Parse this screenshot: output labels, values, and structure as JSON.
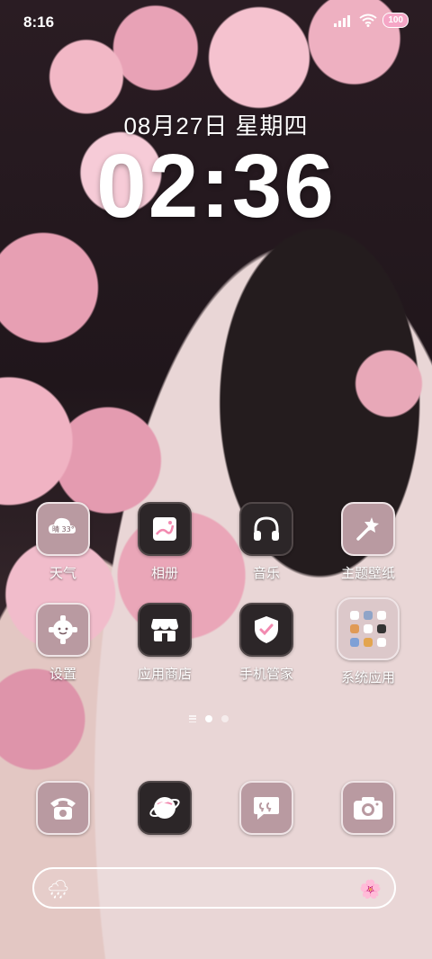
{
  "status": {
    "time": "8:16",
    "battery": "100"
  },
  "lockscreen": {
    "date": "08月27日  星期四",
    "clock": "02:36"
  },
  "apps_row1": [
    {
      "name": "天气",
      "badge_text": "晴 33°"
    },
    {
      "name": "相册"
    },
    {
      "name": "音乐"
    },
    {
      "name": "主题壁纸"
    }
  ],
  "apps_row2": [
    {
      "name": "设置"
    },
    {
      "name": "应用商店"
    },
    {
      "name": "手机管家"
    },
    {
      "name": "系统应用"
    }
  ],
  "dock": [
    {
      "icon": "phone-icon"
    },
    {
      "icon": "browser-icon"
    },
    {
      "icon": "messages-icon"
    },
    {
      "icon": "camera-icon"
    }
  ],
  "search": {
    "left_icon": "🌧",
    "right_icon": "🌸"
  },
  "colors": {
    "accent_pink": "#f5a6c6",
    "tile_light": "#b99aa1",
    "tile_dark": "#2c2628"
  }
}
